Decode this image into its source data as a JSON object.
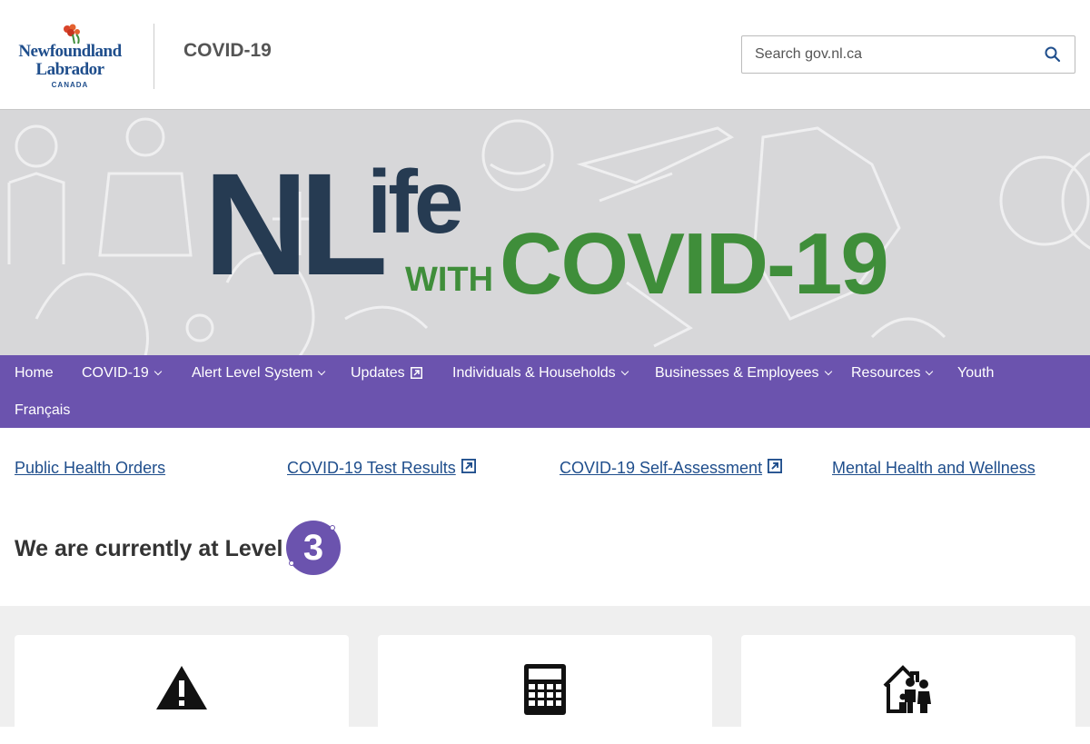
{
  "header": {
    "logo": {
      "line1": "Newfoundland",
      "line2": "Labrador",
      "line3": "CANADA"
    },
    "site_title": "COVID-19",
    "search": {
      "placeholder": "Search gov.nl.ca",
      "icon": "search-icon"
    }
  },
  "banner": {
    "nl": "NL",
    "life": "ife",
    "with": "WITH",
    "covid": "COVID-19",
    "colors": {
      "dark": "#263b52",
      "green": "#3f8e3a",
      "background": "#d7d7d9"
    }
  },
  "nav": {
    "items": [
      {
        "label": "Home",
        "dropdown": false
      },
      {
        "label": "COVID-19",
        "dropdown": true
      },
      {
        "label": "Alert Level System",
        "dropdown": true
      },
      {
        "label": "Updates",
        "external": true
      },
      {
        "label": "Individuals & Households",
        "dropdown": true
      },
      {
        "label": "Businesses & Employees",
        "dropdown": true
      },
      {
        "label": "Resources",
        "dropdown": true
      },
      {
        "label": "Youth",
        "dropdown": false
      },
      {
        "label": "Français",
        "dropdown": false
      }
    ],
    "color": "#6b53ae"
  },
  "quick_links": [
    {
      "label": "Public Health Orders",
      "external": false
    },
    {
      "label": "COVID-19 Test Results",
      "external": true
    },
    {
      "label": "COVID-19 Self-Assessment",
      "external": true
    },
    {
      "label": "Mental Health and Wellness",
      "external": false
    }
  ],
  "alert_level": {
    "text": "We are currently at Level",
    "level": "3",
    "badge_color": "#6b53ae"
  },
  "cards": [
    {
      "icon": "warning-icon"
    },
    {
      "icon": "calculator-icon"
    },
    {
      "icon": "family-home-icon"
    }
  ]
}
